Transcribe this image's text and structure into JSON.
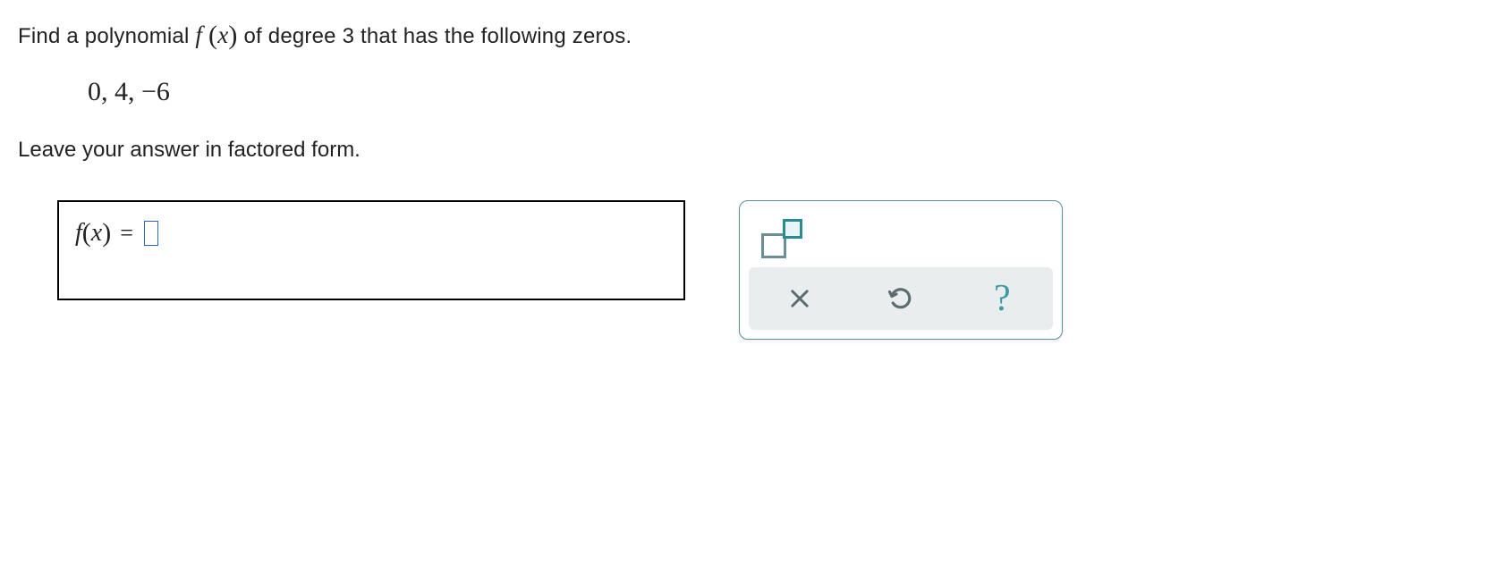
{
  "question": {
    "line1_pre": "Find a polynomial ",
    "line1_post": " of degree 3 that has the following zeros.",
    "zeros": "0,  4,  −6",
    "note": "Leave your answer in factored form."
  },
  "answer": {
    "lhs_f": "f",
    "lhs_x": "x",
    "eq": "="
  },
  "toolbar": {
    "exponent_tool": "exponent-tool",
    "clear": "clear",
    "undo": "undo",
    "help": "?"
  }
}
